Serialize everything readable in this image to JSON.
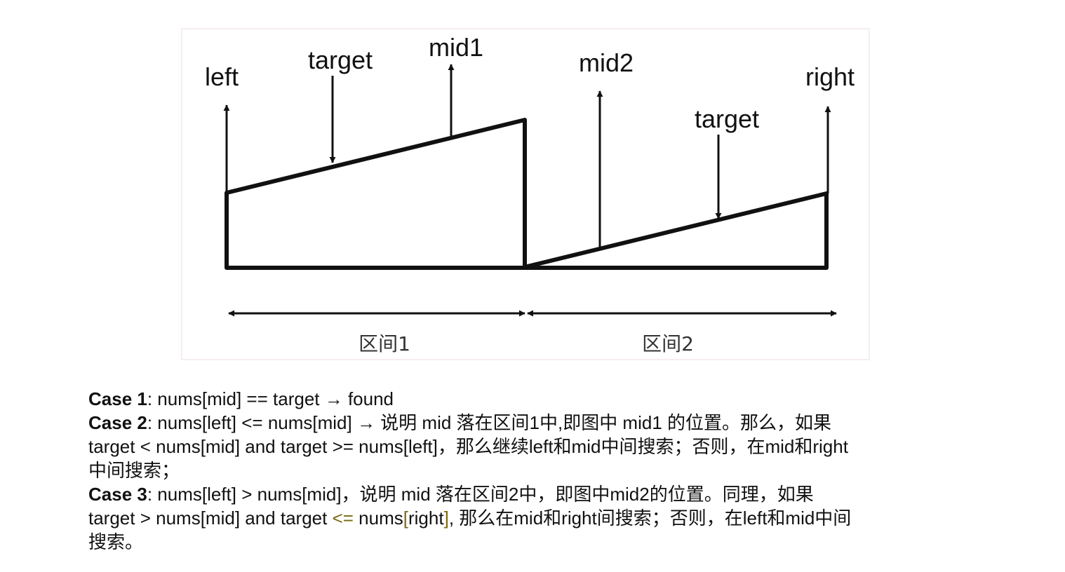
{
  "diagram": {
    "labels": {
      "left": "left",
      "target1": "target",
      "mid1": "mid1",
      "mid2": "mid2",
      "target2": "target",
      "right": "right"
    },
    "zones": {
      "zone1": "区间1",
      "zone2": "区间2"
    },
    "colors": {
      "stroke": "#111111",
      "frame_border": "#f6eeee"
    }
  },
  "caption": {
    "case1": {
      "title": "Case 1",
      "text": ": nums[mid] == target → found"
    },
    "case2": {
      "title": "Case 2",
      "line1": ": nums[left] <= nums[mid] → 说明 mid 落在区间1中,即图中 mid1 的位置。那么，如果",
      "line2": "target < nums[mid] and target >= nums[left]，那么继续left和mid中间搜索；否则，在mid和right",
      "line3": "中间搜索；"
    },
    "case3": {
      "title": "Case 3",
      "line1": ":  nums[left] > nums[mid]，说明 mid 落在区间2中，即图中mid2的位置。同理，如果",
      "line2_a": "target > nums[mid] and target ",
      "line2_op": "<=",
      "line2_b": " nums",
      "line2_bracket_open": "[",
      "line2_c": "right",
      "line2_bracket_close": "]",
      "line2_d": ", 那么在mid和right间搜索；否则，在left和mid中间",
      "line3": "搜索。"
    },
    "highlight_color": "#7a6a10"
  }
}
